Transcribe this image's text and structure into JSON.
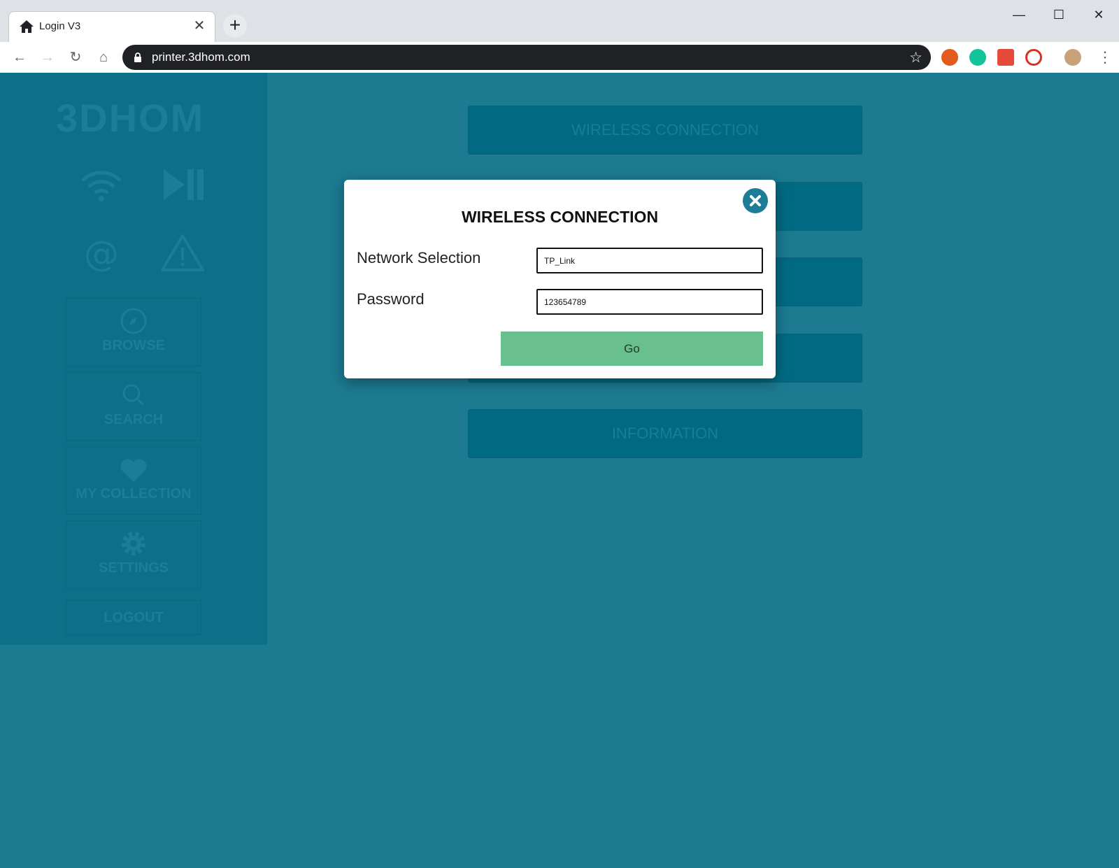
{
  "browser": {
    "tab_title": "Login V3",
    "tab_close_glyph": "✕",
    "new_tab_glyph": "+",
    "url": "printer.3dhom.com",
    "window_controls": {
      "minimize": "—",
      "maximize": "☐",
      "close": "✕"
    },
    "nav_glyphs": {
      "back": "←",
      "forward": "→",
      "reload": "↻",
      "home": "⌂",
      "star": "☆",
      "menu": "⋮"
    }
  },
  "sidebar": {
    "logo": "3DHOM",
    "items": [
      {
        "label": "BROWSE",
        "icon": "compass-icon"
      },
      {
        "label": "SEARCH",
        "icon": "search-icon"
      },
      {
        "label": "MY COLLECTION",
        "icon": "heart-icon"
      },
      {
        "label": "SETTINGS",
        "icon": "gear-icon"
      },
      {
        "label": "LOGOUT"
      }
    ]
  },
  "menu": {
    "items": [
      {
        "label": "WIRELESS CONNECTION"
      },
      {
        "label": ""
      },
      {
        "label": ""
      },
      {
        "label": ""
      },
      {
        "label": "INFORMATION"
      }
    ]
  },
  "modal": {
    "title": "WIRELESS CONNECTION",
    "network_label": "Network Selection",
    "network_value": "TP_Link",
    "password_label": "Password",
    "password_value": "123654789",
    "go_label": "Go"
  },
  "colors": {
    "page_bg": "#1c7a91",
    "sidebar_bg": "#0e6f89",
    "go_button": "#6abf8f",
    "close_button": "#1d7d96"
  }
}
